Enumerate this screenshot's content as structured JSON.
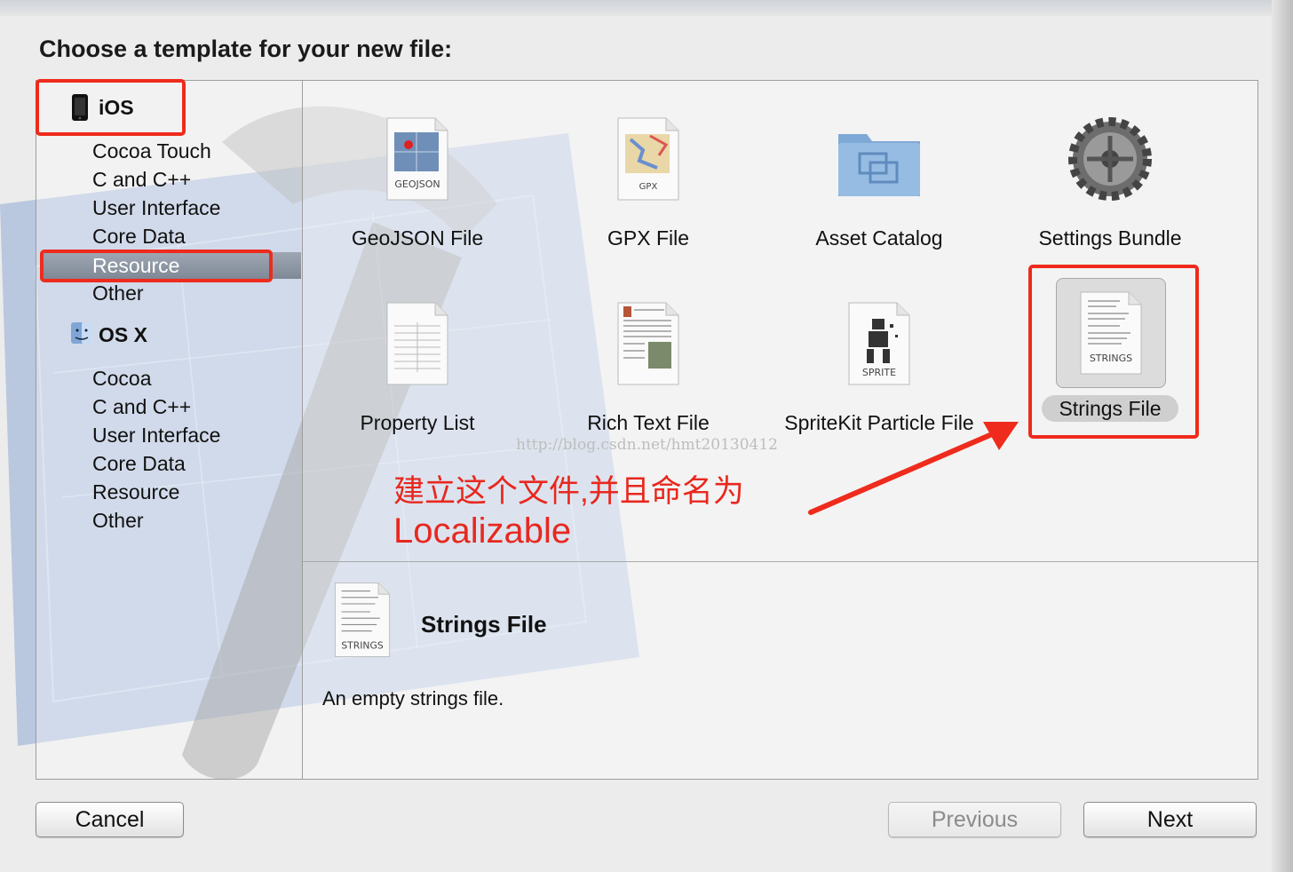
{
  "heading": "Choose a template for your new file:",
  "sidebar": {
    "ios_group": "iOS",
    "ios_items": [
      "Cocoa Touch",
      "C and C++",
      "User Interface",
      "Core Data",
      "Resource",
      "Other"
    ],
    "osx_group": "OS X",
    "osx_items": [
      "Cocoa",
      "C and C++",
      "User Interface",
      "Core Data",
      "Resource",
      "Other"
    ],
    "selected": "Resource"
  },
  "templates": {
    "geojson": {
      "label": "GeoJSON File",
      "badge": "GEOJSON"
    },
    "gpx": {
      "label": "GPX File",
      "badge": "GPX"
    },
    "asset": {
      "label": "Asset Catalog"
    },
    "settings": {
      "label": "Settings Bundle"
    },
    "plist": {
      "label": "Property List"
    },
    "rtf": {
      "label": "Rich Text File"
    },
    "sprite": {
      "label": "SpriteKit Particle File",
      "badge": "SPRITE"
    },
    "strings": {
      "label": "Strings File",
      "badge": "STRINGS"
    }
  },
  "selected_template": "Strings File",
  "watermark": "http://blog.csdn.net/hmt20130412",
  "annotation": {
    "line1": "建立这个文件,并且命名为",
    "line2": "Localizable",
    "color": "#e8281f"
  },
  "detail": {
    "title": "Strings File",
    "description": "An empty strings file.",
    "badge": "STRINGS"
  },
  "buttons": {
    "cancel": "Cancel",
    "previous": "Previous",
    "next": "Next"
  }
}
